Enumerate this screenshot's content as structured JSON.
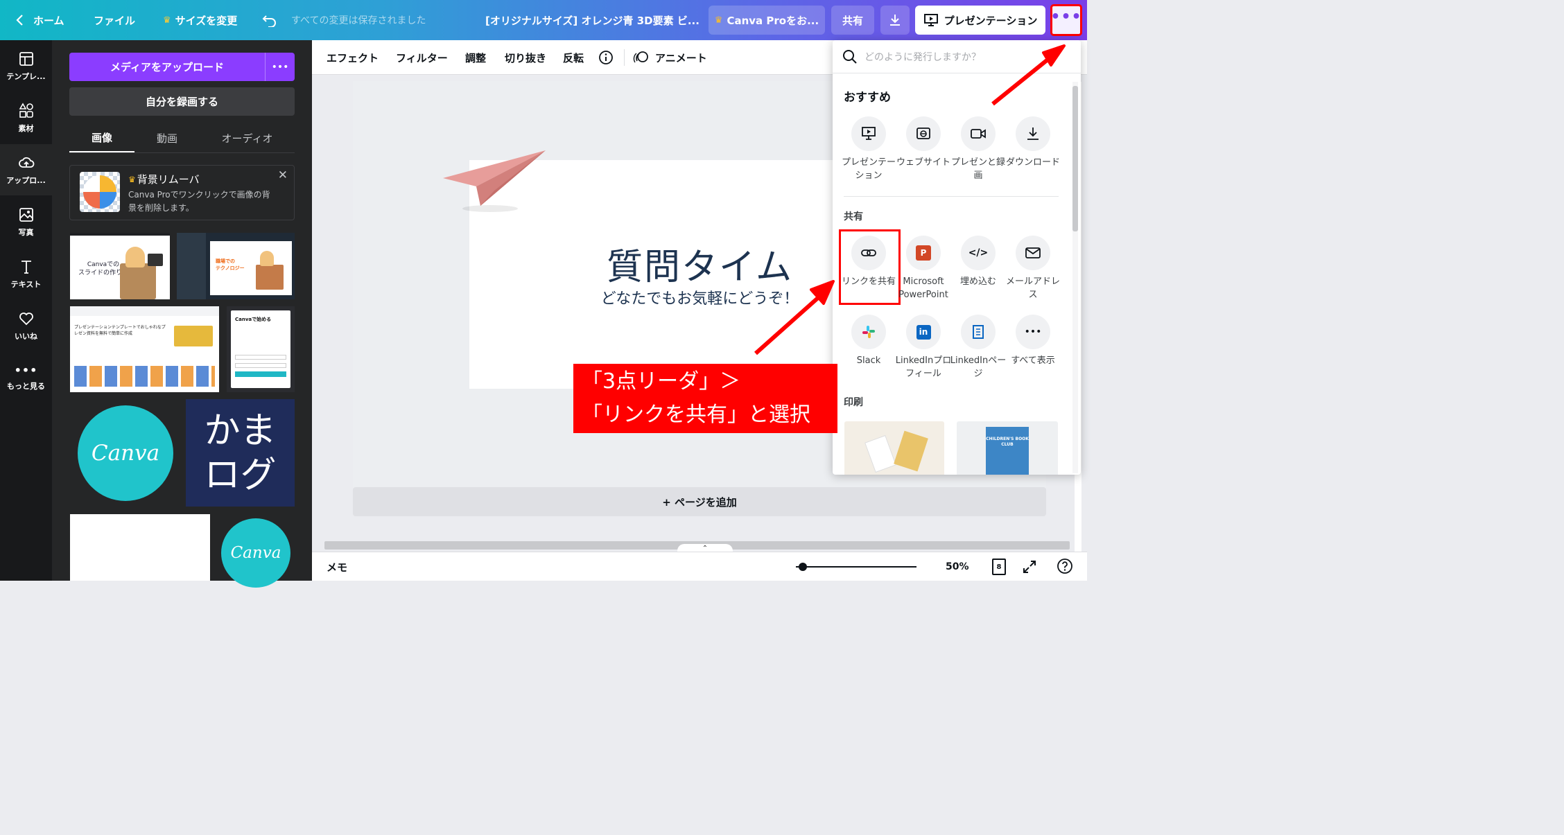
{
  "topbar": {
    "home": "ホーム",
    "file": "ファイル",
    "resize": "サイズを変更",
    "saved_status": "すべての変更は保存されました",
    "doc_title": "[オリジナルサイズ] オレンジ青 3D要素 ビ...",
    "canva_pro": "Canva Proをお...",
    "share": "共有",
    "present": "プレゼンテーション"
  },
  "rail": {
    "items": [
      {
        "label": "テンプレ..."
      },
      {
        "label": "素材"
      },
      {
        "label": "アップロ..."
      },
      {
        "label": "写真"
      },
      {
        "label": "テキスト"
      },
      {
        "label": "いいね"
      },
      {
        "label": "もっと見る"
      }
    ]
  },
  "panel": {
    "upload_button": "メディアをアップロード",
    "record_button": "自分を録画する",
    "tabs": [
      "画像",
      "動画",
      "オーディオ"
    ],
    "promo_title": "背景リムーバ",
    "promo_desc_1": "Canva Proでワンクリックで画像の背",
    "promo_desc_2": "景を削除します。",
    "thumb1_line1": "Canvaでの",
    "thumb1_line2": "スライドの作り方",
    "thumb2_line1": "職場での",
    "thumb2_line2": "テクノロジー",
    "thumb3_title_1": "プレゼンテーションテンプレートでおしゃれなプ",
    "thumb3_title_2": "レゼン資料を無料で簡単に作成",
    "thumb4_title": "Canvaで始める",
    "logo_text": "Canva",
    "blog_line1": "かま",
    "blog_line2": "ログ"
  },
  "toolbar2": {
    "effect": "エフェクト",
    "filter": "フィルター",
    "adjust": "調整",
    "crop": "切り抜き",
    "flip": "反転",
    "animate": "アニメート"
  },
  "slide": {
    "title": "質問タイム",
    "subtitle": "どなたでもお気軽にどうぞ！"
  },
  "add_page": "+ ページを追加",
  "popup": {
    "search_placeholder": "どのように発行しますか？",
    "recommended": "おすすめ",
    "rec_items": [
      {
        "label": "プレゼンテーション",
        "icon": "present-icon"
      },
      {
        "label": "ウェブサイト",
        "icon": "website-icon"
      },
      {
        "label": "プレゼンと録画",
        "icon": "record-icon"
      },
      {
        "label": "ダウンロード",
        "icon": "download-icon"
      }
    ],
    "share_heading": "共有",
    "share_items": [
      {
        "label": "リンクを共有",
        "icon": "link-icon"
      },
      {
        "label": "Microsoft PowerPoint",
        "icon": "powerpoint-icon"
      },
      {
        "label": "埋め込む",
        "icon": "embed-icon"
      },
      {
        "label": "メールアドレス",
        "icon": "mail-icon"
      },
      {
        "label": "Slack",
        "icon": "slack-icon"
      },
      {
        "label": "LinkedInプロフィール",
        "icon": "linkedin-icon"
      },
      {
        "label": "LinkedInページ",
        "icon": "linkedin-page-icon"
      },
      {
        "label": "すべて表示",
        "icon": "more-icon"
      }
    ],
    "print_heading": "印刷",
    "print_card2_text": "CHILDREN'S BOOK CLUB"
  },
  "annotation": {
    "line1": "「3点リーダ」＞",
    "line2": "「リンクを共有」と選択"
  },
  "bottombar": {
    "notes": "メモ",
    "zoom": "50%",
    "page_count": "8"
  },
  "colors": {
    "purple": "#8b3dff",
    "annotation_red": "#ff0000",
    "slide_title": "#1d3350"
  }
}
